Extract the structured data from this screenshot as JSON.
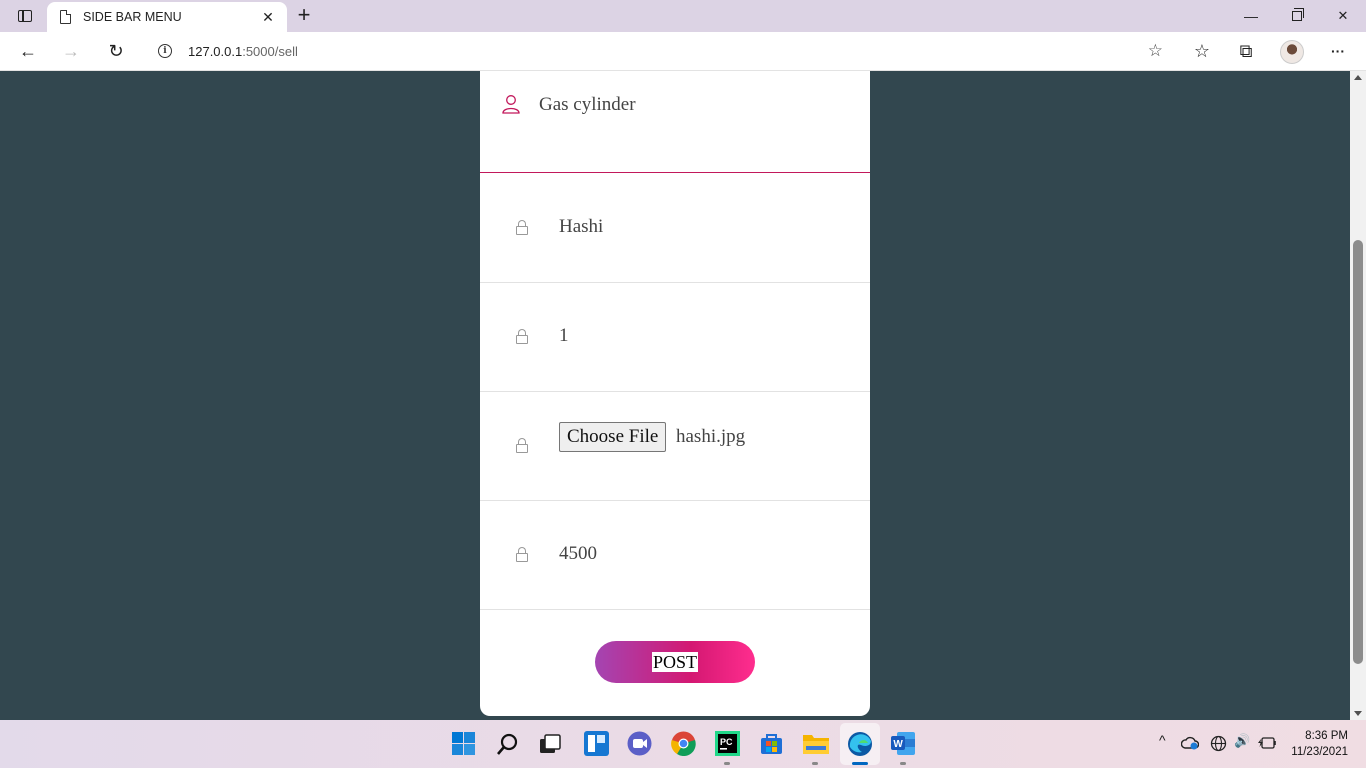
{
  "browser": {
    "tab_title": "SIDE BAR MENU",
    "tab_close": "✕",
    "new_tab": "+",
    "url_host": "127.0.0.1",
    "url_path": ":5000/sell",
    "info_glyph": "i",
    "window_minimize": "—",
    "window_close": "✕",
    "back": "←",
    "forward": "→",
    "refresh": "↻",
    "favorites_add": "☆",
    "favorites": "☆",
    "collections": "⧉",
    "more": "···"
  },
  "form": {
    "product_name": "Gas cylinder",
    "field_seller": "Hashi",
    "field_quantity": "1",
    "file_button": "Choose File",
    "file_name": "hashi.jpg",
    "field_price": "4500",
    "submit_label": "POST"
  },
  "colors": {
    "page_bg": "#32474f",
    "accent": "#c2185b",
    "button_gradient_start": "#a445b2",
    "button_gradient_end": "#ff2d8e"
  },
  "taskbar": {
    "time": "8:36 PM",
    "date": "11/23/2021",
    "tray_chevron": "^",
    "tray_volume": "🔊"
  }
}
